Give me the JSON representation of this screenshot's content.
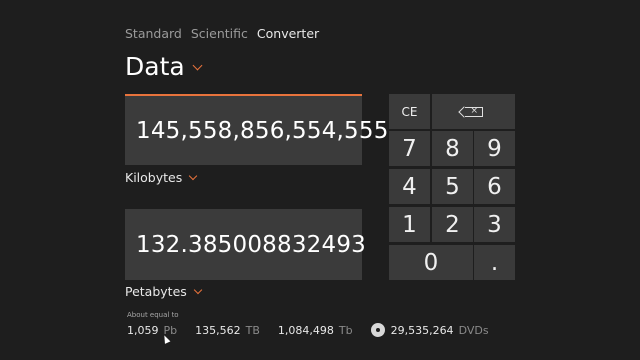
{
  "tabs": [
    {
      "label": "Standard",
      "active": false
    },
    {
      "label": "Scientific",
      "active": false
    },
    {
      "label": "Converter",
      "active": true
    }
  ],
  "category": {
    "label": "Data"
  },
  "input": {
    "value": "145,558,856,554,555",
    "unit": "Kilobytes"
  },
  "output": {
    "value": "132.385008832493",
    "unit": "Petabytes"
  },
  "keypad": {
    "clear_entry": "CE",
    "backspace_icon": "backspace-icon",
    "keys": [
      "7",
      "8",
      "9",
      "4",
      "5",
      "6",
      "1",
      "2",
      "3",
      "0",
      "."
    ]
  },
  "about": {
    "label": "About equal to",
    "items": [
      {
        "value": "1,059",
        "unit": "Pb"
      },
      {
        "value": "135,562",
        "unit": "TB"
      },
      {
        "value": "1,084,498",
        "unit": "Tb"
      },
      {
        "value": "29,535,264",
        "unit": "DVDs",
        "icon": "dvd-icon"
      }
    ]
  },
  "colors": {
    "accent": "#e8733c",
    "background": "#1e1e1e",
    "field": "#3b3b3b",
    "key": "#3a3a3a"
  }
}
